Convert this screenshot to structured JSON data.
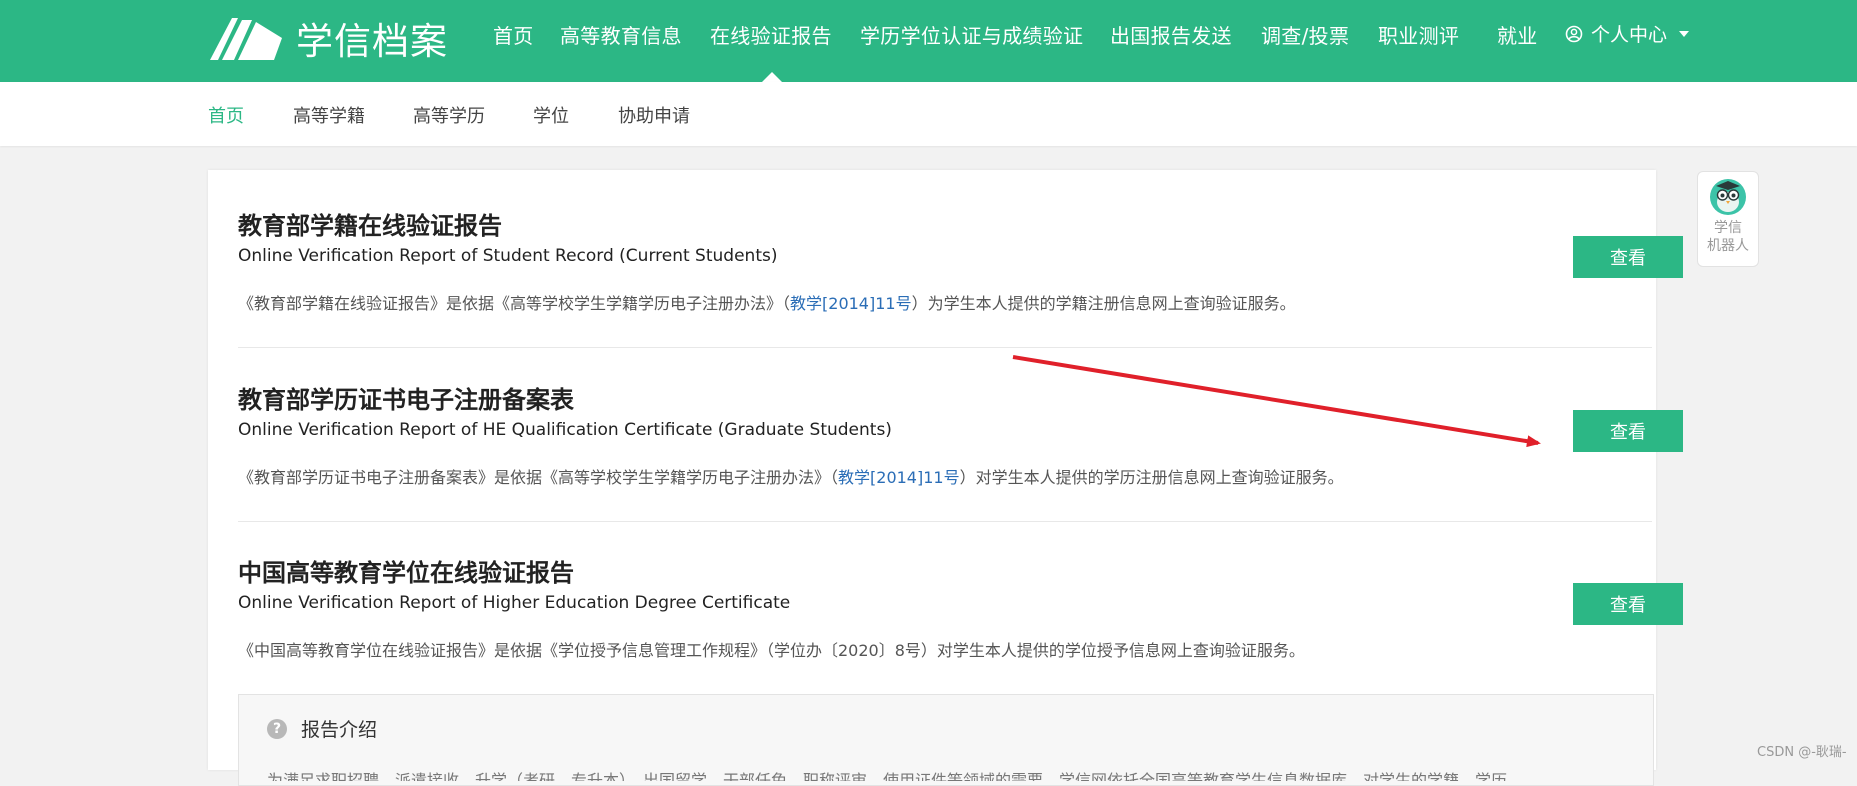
{
  "header": {
    "logo_text": "学信档案",
    "nav": [
      {
        "label": "首页"
      },
      {
        "label": "高等教育信息"
      },
      {
        "label": "在线验证报告"
      },
      {
        "label": "学历学位认证与成绩验证"
      },
      {
        "label": "出国报告发送"
      },
      {
        "label": "调查/投票"
      },
      {
        "label": "职业测评"
      },
      {
        "label": "就业"
      }
    ],
    "active_nav": "在线验证报告",
    "user_menu_label": "个人中心"
  },
  "subnav": {
    "items": [
      {
        "label": "首页"
      },
      {
        "label": "高等学籍"
      },
      {
        "label": "高等学历"
      },
      {
        "label": "学位"
      },
      {
        "label": "协助申请"
      }
    ],
    "active": "首页"
  },
  "reports": [
    {
      "title": "教育部学籍在线验证报告",
      "subtitle": "Online Verification Report of Student Record (Current Students)",
      "desc_before": "《教育部学籍在线验证报告》是依据《高等学校学生学籍学历电子注册办法》（",
      "desc_link": "教学[2014]11号",
      "desc_after": "）为学生本人提供的学籍注册信息网上查询验证服务。",
      "button_label": "查看"
    },
    {
      "title": "教育部学历证书电子注册备案表",
      "subtitle": "Online Verification Report of HE Qualification Certificate (Graduate Students)",
      "desc_before": "《教育部学历证书电子注册备案表》是依据《高等学校学生学籍学历电子注册办法》（",
      "desc_link": "教学[2014]11号",
      "desc_after": "）对学生本人提供的学历注册信息网上查询验证服务。",
      "button_label": "查看"
    },
    {
      "title": "中国高等教育学位在线验证报告",
      "subtitle": "Online Verification Report of Higher Education Degree Certificate",
      "desc_before": "《中国高等教育学位在线验证报告》是依据《学位授予信息管理工作规程》（学位办〔2020〕8号）对学生本人提供的学位授予信息网上查询验证服务。",
      "desc_link": "",
      "desc_after": "",
      "button_label": "查看"
    }
  ],
  "intro": {
    "heading": "报告介绍",
    "text": "为满足求职招聘、派遣接收、升学（考研、专升本）、出国留学、干部任免、职称评审、使用证件等领域的需要，学信网依托全国高等教育学生信息数据库，对学生的学籍、学历"
  },
  "robot": {
    "label_line1": "学信",
    "label_line2": "机器人"
  },
  "watermark": "CSDN @-耿瑞-",
  "colors": {
    "brand": "#2cb785",
    "link": "#2a6db6",
    "annotation_arrow": "#e0202a"
  }
}
